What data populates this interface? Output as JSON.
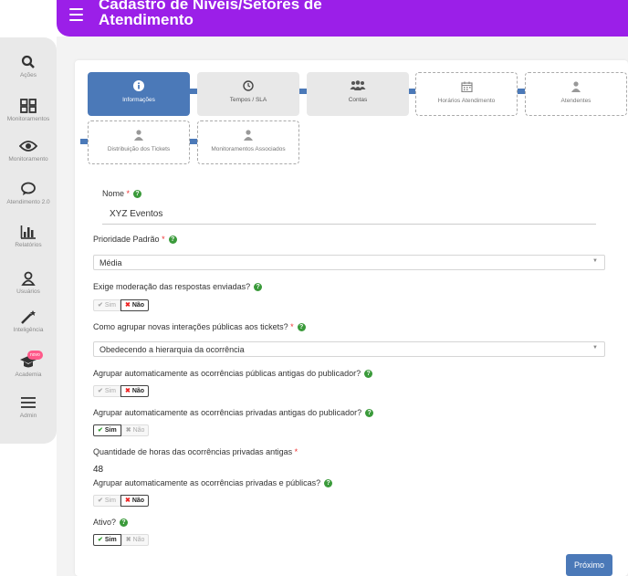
{
  "header": {
    "title": "Cadastro de Níveis/Setores de Atendimento"
  },
  "sidebar": {
    "items": [
      {
        "label": "Ações",
        "icon": "search-icon"
      },
      {
        "label": "Monitoramentos",
        "icon": "grid-icon"
      },
      {
        "label": "Monitoramento",
        "icon": "eye-icon"
      },
      {
        "label": "Atendimento 2.0",
        "icon": "chat-icon"
      },
      {
        "label": "Relatórios",
        "icon": "bar-chart-icon"
      },
      {
        "label": "Usuários",
        "icon": "user-icon"
      },
      {
        "label": "Inteligência",
        "icon": "magic-wand-icon"
      },
      {
        "label": "Academia",
        "icon": "graduation-cap-icon",
        "badge": "novo"
      },
      {
        "label": "Admin",
        "icon": "menu-icon"
      }
    ]
  },
  "steps": [
    {
      "label": "Informações",
      "icon": "info-icon",
      "state": "active"
    },
    {
      "label": "Tempos / SLA",
      "icon": "clock-icon",
      "state": "done"
    },
    {
      "label": "Contas",
      "icon": "users-icon",
      "state": "done"
    },
    {
      "label": "Horários Atendimento",
      "icon": "calendar-icon",
      "state": "todo"
    },
    {
      "label": "Atendentes",
      "icon": "user-icon",
      "state": "todo"
    },
    {
      "label": "Distribuição dos Tickets",
      "icon": "user-icon",
      "state": "todo"
    },
    {
      "label": "Monitoramentos Associados",
      "icon": "user-icon",
      "state": "todo"
    }
  ],
  "form": {
    "nome": {
      "label": "Nome",
      "value": "XYZ Eventos"
    },
    "prioridade": {
      "label": "Prioridade Padrão",
      "value": "Média"
    },
    "moderacao": {
      "label": "Exige moderação das respostas enviadas?",
      "yes": "Sim",
      "no": "Não"
    },
    "agrupar": {
      "label": "Como agrupar novas interações públicas aos tickets?",
      "value": "Obedecendo a hierarquia da ocorrência"
    },
    "auto_publicas": {
      "label": "Agrupar automaticamente as ocorrências públicas antigas do publicador?",
      "yes": "Sim",
      "no": "Não"
    },
    "auto_privadas": {
      "label": "Agrupar automaticamente as ocorrências privadas antigas do publicador?",
      "yes": "Sim",
      "no": "Não"
    },
    "horas": {
      "label": "Quantidade de horas das ocorrências privadas antigas",
      "value": "48"
    },
    "auto_mistas": {
      "label": "Agrupar automaticamente as ocorrências privadas e públicas?",
      "yes": "Sim",
      "no": "Não"
    },
    "ativo": {
      "label": "Ativo?",
      "yes": "Sim",
      "no": "Não"
    }
  },
  "buttons": {
    "next": "Próximo"
  },
  "colors": {
    "header": "#9b1fe8",
    "accent": "#4b79b8",
    "help": "#3a9a3a"
  }
}
